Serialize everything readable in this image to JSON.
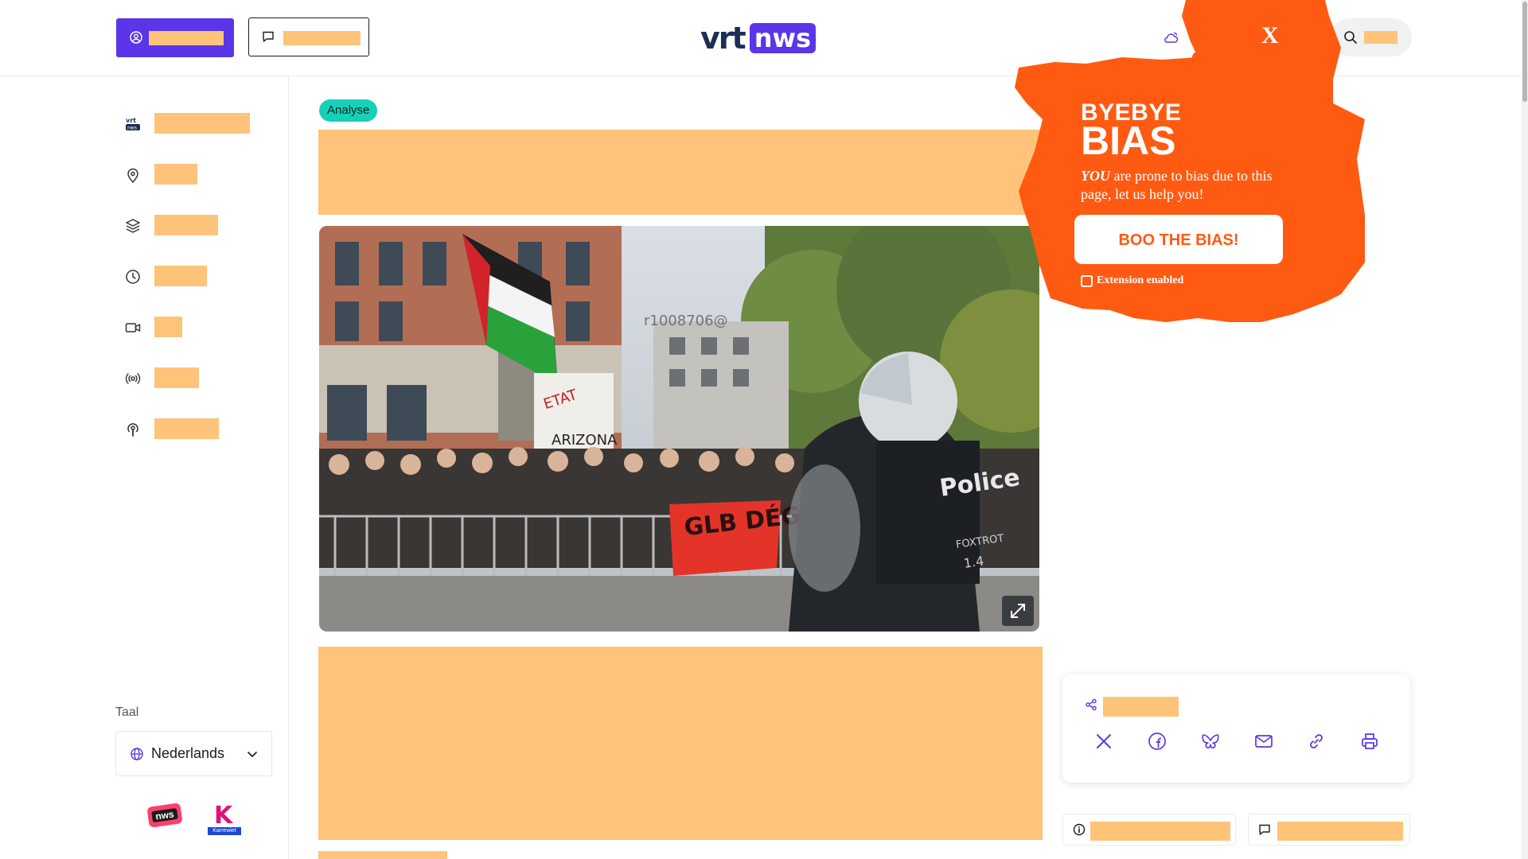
{
  "header": {
    "logo_vrt": "vrt",
    "logo_nws": "nws",
    "weather_icon": "cloud-sun-icon",
    "search_icon": "search-icon"
  },
  "sidebar": {
    "items": [
      {
        "icon": "vrt-nws-icon",
        "redact_width": 120
      },
      {
        "icon": "location-pin-icon",
        "redact_width": 54
      },
      {
        "icon": "layers-icon",
        "redact_width": 80
      },
      {
        "icon": "clock-icon",
        "redact_width": 66
      },
      {
        "icon": "video-camera-icon",
        "redact_width": 35
      },
      {
        "icon": "broadcast-icon",
        "redact_width": 56
      },
      {
        "icon": "podcast-icon",
        "redact_width": 81
      }
    ],
    "language_label": "Taal",
    "language_value": "Nederlands"
  },
  "article": {
    "tag": "Analyse",
    "image_watermark": "r1008706@",
    "image_text_police": "Police",
    "image_text_foxtrot": "FOXTROT",
    "image_text_unit": "1.4",
    "image_banner": "GLB DÉGAGE",
    "image_sign_etat": "ETAT GÉNOCIDAIRE",
    "image_sign_arizona": "ARIZONA"
  },
  "share": {
    "buttons": [
      "x-icon",
      "facebook-icon",
      "bluesky-icon",
      "mail-icon",
      "link-icon",
      "print-icon"
    ]
  },
  "extension": {
    "title_line1": "BYEBYE",
    "title_line2": "BIAS",
    "message_you": "YOU",
    "message_rest": "are prone to bias due to this page, let us help you!",
    "cta": "BOO THE BIAS!",
    "status": "Extension enabled",
    "close": "X"
  },
  "footer_badges": {
    "nws": "nws",
    "karrewiet_letter": "K",
    "karrewiet_label": "Karrewiet"
  },
  "colors": {
    "brand_purple": "#5a36e8",
    "redaction": "#ffc37a",
    "tag_teal": "#18d0b8",
    "extension_orange": "#ff5a12"
  }
}
